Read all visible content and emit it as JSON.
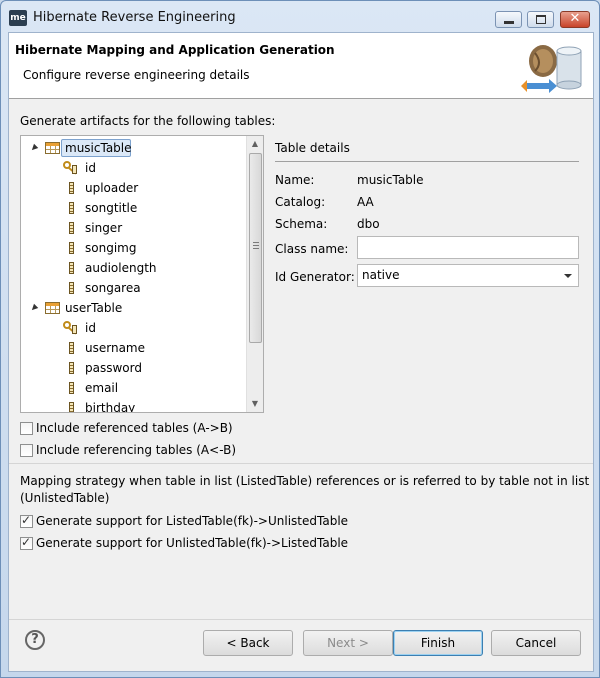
{
  "window": {
    "app_icon": "me",
    "title": "Hibernate Reverse Engineering",
    "controls": {
      "minimize_icon": "minimize-icon",
      "maximize_icon": "maximize-icon",
      "close_icon": "close-icon",
      "close_glyph": "✕"
    }
  },
  "banner": {
    "title": "Hibernate Mapping and Application Generation",
    "subtitle": "Configure reverse engineering details"
  },
  "artifacts_label": "Generate artifacts for the following tables:",
  "tree": {
    "tables": [
      {
        "name": "musicTable",
        "selected": true,
        "columns": [
          "id",
          "uploader",
          "songtitle",
          "singer",
          "songimg",
          "audiolength",
          "songarea"
        ],
        "key_columns": [
          "id"
        ]
      },
      {
        "name": "userTable",
        "selected": false,
        "columns": [
          "id",
          "username",
          "password",
          "email",
          "birthday"
        ],
        "key_columns": [
          "id"
        ]
      }
    ]
  },
  "details": {
    "heading": "Table details",
    "name_label": "Name:",
    "name_value": "musicTable",
    "catalog_label": "Catalog:",
    "catalog_value": "AA",
    "schema_label": "Schema:",
    "schema_value": "dbo",
    "class_name_label": "Class name:",
    "class_name_value": "",
    "id_generator_label": "Id Generator:",
    "id_generator_value": "native"
  },
  "options": {
    "include_referenced": {
      "label": "Include referenced tables (A->B)",
      "checked": false
    },
    "include_referencing": {
      "label": "Include referencing tables (A<-B)",
      "checked": false
    }
  },
  "strategy": {
    "text_line1": "Mapping strategy when table in list (ListedTable) references or is referred to by table not in list",
    "text_line2": "(UnlistedTable)",
    "listed_to_unlisted": {
      "label": "Generate support for ListedTable(fk)->UnlistedTable",
      "checked": true
    },
    "unlisted_to_listed": {
      "label": "Generate support for UnlistedTable(fk)->ListedTable",
      "checked": true
    }
  },
  "footer": {
    "help_glyph": "?",
    "back_label": "< Back",
    "next_label": "Next >",
    "finish_label": "Finish",
    "cancel_label": "Cancel"
  }
}
